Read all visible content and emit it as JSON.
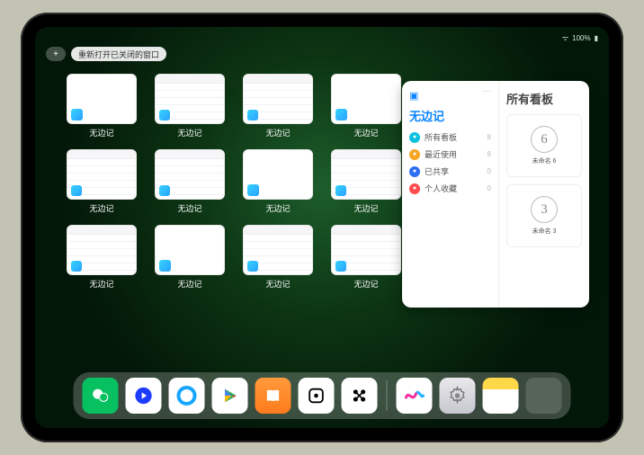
{
  "status": {
    "battery": "100%"
  },
  "topbar": {
    "add": "+",
    "reopen": "重新打开已关闭的窗口"
  },
  "app": {
    "name": "无边记"
  },
  "grid": {
    "items": [
      {
        "label": "无边记",
        "style": "blank"
      },
      {
        "label": "无边记",
        "style": "content"
      },
      {
        "label": "无边记",
        "style": "content"
      },
      {
        "label": "无边记",
        "style": "blank"
      },
      {
        "label": "无边记",
        "style": "content"
      },
      {
        "label": "无边记",
        "style": "content"
      },
      {
        "label": "无边记",
        "style": "blank"
      },
      {
        "label": "无边记",
        "style": "content"
      },
      {
        "label": "无边记",
        "style": "content"
      },
      {
        "label": "无边记",
        "style": "blank"
      },
      {
        "label": "无边记",
        "style": "content"
      },
      {
        "label": "无边记",
        "style": "content"
      }
    ]
  },
  "panel": {
    "more": "···",
    "left_title": "无边记",
    "right_title": "所有看板",
    "categories": [
      {
        "label": "所有看板",
        "count": "8",
        "color": "#0ac2e0"
      },
      {
        "label": "最近使用",
        "count": "8",
        "color": "#f6a623"
      },
      {
        "label": "已共享",
        "count": "0",
        "color": "#2e6ff2"
      },
      {
        "label": "个人收藏",
        "count": "0",
        "color": "#ff4d4d"
      }
    ],
    "boards": [
      {
        "digit": "6",
        "caption": "未命名 6"
      },
      {
        "digit": "3",
        "caption": "未命名 3"
      }
    ]
  },
  "dock": {
    "items": [
      {
        "name": "wechat"
      },
      {
        "name": "tencent-video"
      },
      {
        "name": "qq-browser"
      },
      {
        "name": "play-store"
      },
      {
        "name": "books"
      },
      {
        "name": "dice-app"
      },
      {
        "name": "connect-app"
      },
      {
        "name": "freeform"
      },
      {
        "name": "settings"
      },
      {
        "name": "notes"
      },
      {
        "name": "recent-apps"
      }
    ]
  }
}
